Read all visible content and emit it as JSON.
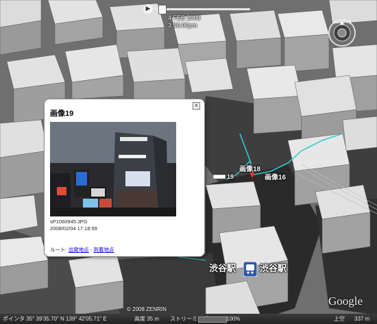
{
  "time_slider": {
    "date": "4 FEB 2008",
    "time": "3:56:06pm",
    "play_icon": "play-icon"
  },
  "compass": {
    "north_label": "N",
    "icon": "compass-icon"
  },
  "popup": {
    "title": "画像19",
    "close_label": "x",
    "photo_icon": "photo-thumbnail",
    "filename": "sP1060945.JPG",
    "datetime": "2008/02/04 17:18:59",
    "route_label": "ルート:",
    "route_from": "出発地点",
    "route_sep": " - ",
    "route_to": "到着地点"
  },
  "map_labels": {
    "image18": "画像18",
    "image16": "画像16",
    "image19_partial": "19",
    "station_left": "渋谷駅",
    "station_right": "渋谷駅",
    "station_icon": "train-station-icon"
  },
  "branding": {
    "copyright": "© 2008 ZENRIN",
    "logo": "Google"
  },
  "statusbar": {
    "pointer": "ポインタ 35° 39'35.70\" N  139° 42'05.71\" E",
    "elevation": "高度  35 m",
    "streaming": "ストリーミング",
    "streaming_pct": "100%",
    "eye_alt_label": "上空",
    "eye_alt": "337 m"
  }
}
